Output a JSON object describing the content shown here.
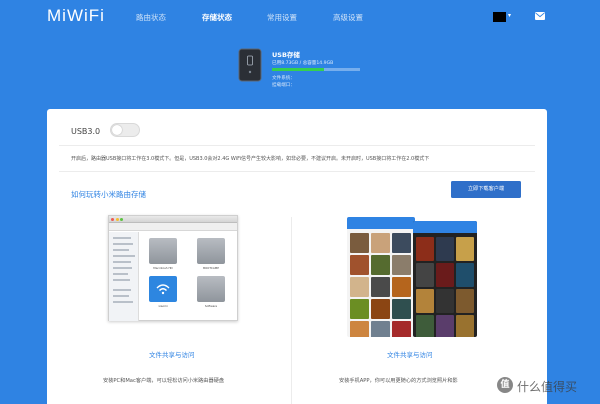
{
  "header": {
    "logo": "MiWiFi",
    "nav": [
      {
        "label": "路由状态",
        "active": false
      },
      {
        "label": "存储状态",
        "active": true
      },
      {
        "label": "常用设置",
        "active": false
      },
      {
        "label": "高级设置",
        "active": false
      }
    ],
    "account_arrow": "▾",
    "account_icon": "black-square-avatar",
    "mail_icon": "mail-icon"
  },
  "storage": {
    "title": "USB存储",
    "usage": "已用8.73GB / 总容量14.9GB",
    "usage_fraction": 0.586,
    "filesystem": "文件系统：",
    "port": "挂载端口：",
    "bar_color": "#35d04f"
  },
  "settings": {
    "usb3_label": "USB3.0",
    "usb3_enabled": false,
    "notice": "开启后，路由器USB接口将工作在3.0模式下。但是，USB3.0会对2.4G WiFi信号产生较大影响，如非必要，不建议开启。未开启时，USB接口将工作在2.0模式下"
  },
  "guide": {
    "title": "如何玩转小米路由存储",
    "download_button": "立即下载客户端",
    "pc": {
      "caption": "文件共享与访问",
      "description": "安装PC和Mac客户端，可以轻松访问小米路由器硬盘",
      "drive_labels": [
        "Macintosh HD",
        "BOOTCAMP",
        "xiaomi",
        "Software"
      ]
    },
    "mobile": {
      "caption": "文件共享与访问",
      "description": "安装手机APP，你可以用更随心的方式浏览照片和影"
    }
  },
  "watermark": {
    "badge": "值",
    "text": "什么值得买"
  },
  "colors": {
    "background": "#2f83e3",
    "accent": "#2f83e3",
    "button": "#2f6fc9"
  }
}
